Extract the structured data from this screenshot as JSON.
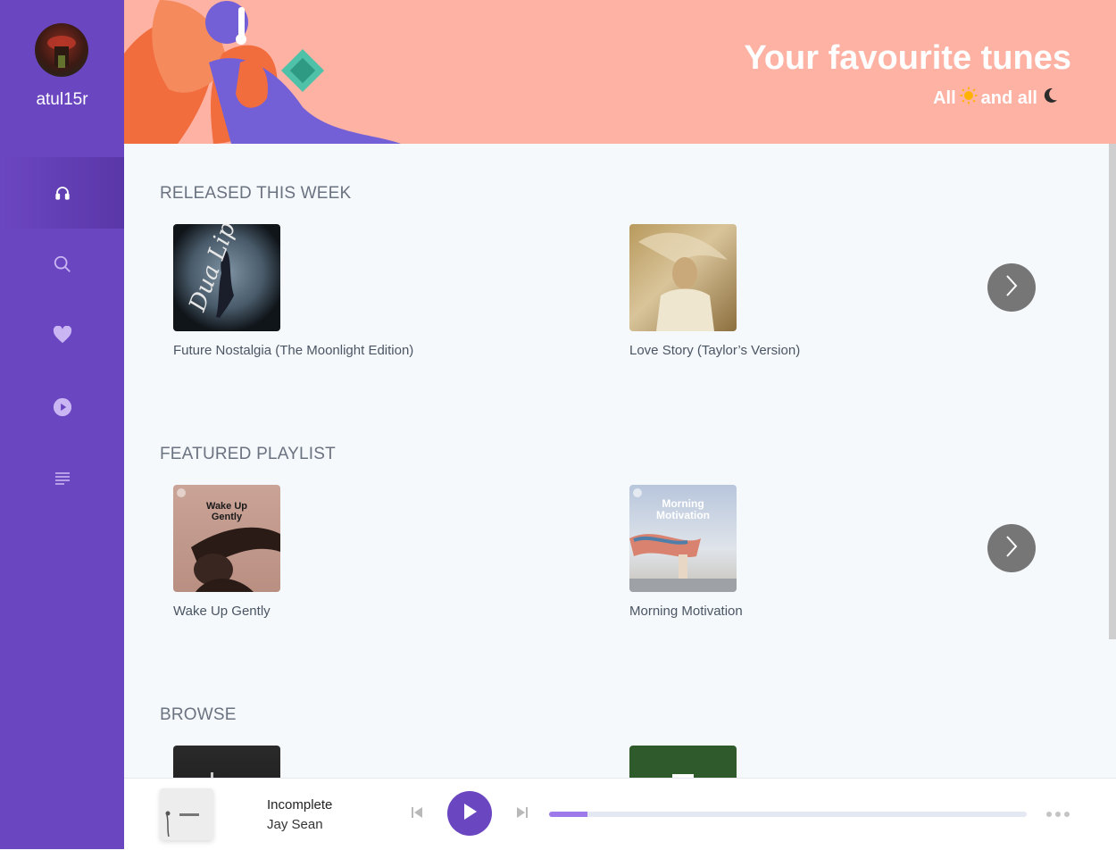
{
  "sidebar": {
    "username": "atul15r",
    "nav": [
      {
        "name": "headphones-icon",
        "active": true
      },
      {
        "name": "search-icon",
        "active": false
      },
      {
        "name": "heart-icon",
        "active": false
      },
      {
        "name": "play-circle-icon",
        "active": false
      },
      {
        "name": "queue-list-icon",
        "active": false
      }
    ]
  },
  "banner": {
    "title": "Your favourite tunes",
    "subtitle_part1": "All",
    "subtitle_part2": "and all"
  },
  "sections": {
    "released": {
      "title": "RELEASED THIS WEEK",
      "items": [
        {
          "label": "Future Nostalgia (The Moonlight Edition)"
        },
        {
          "label": "Love Story (Taylor’s Version)"
        }
      ]
    },
    "featured": {
      "title": "FEATURED PLAYLIST",
      "items": [
        {
          "label": "Wake Up Gently",
          "cover_text": "Wake Up Gently"
        },
        {
          "label": "Morning Motivation",
          "cover_text": "Morning Motivation"
        }
      ]
    },
    "browse": {
      "title": "BROWSE"
    }
  },
  "player": {
    "title": "Incomplete",
    "artist": "Jay Sean",
    "progress": 0.08
  },
  "colors": {
    "sidebar": "#6b46c1",
    "banner": "#feb2a4",
    "accent": "#9f7aea"
  }
}
